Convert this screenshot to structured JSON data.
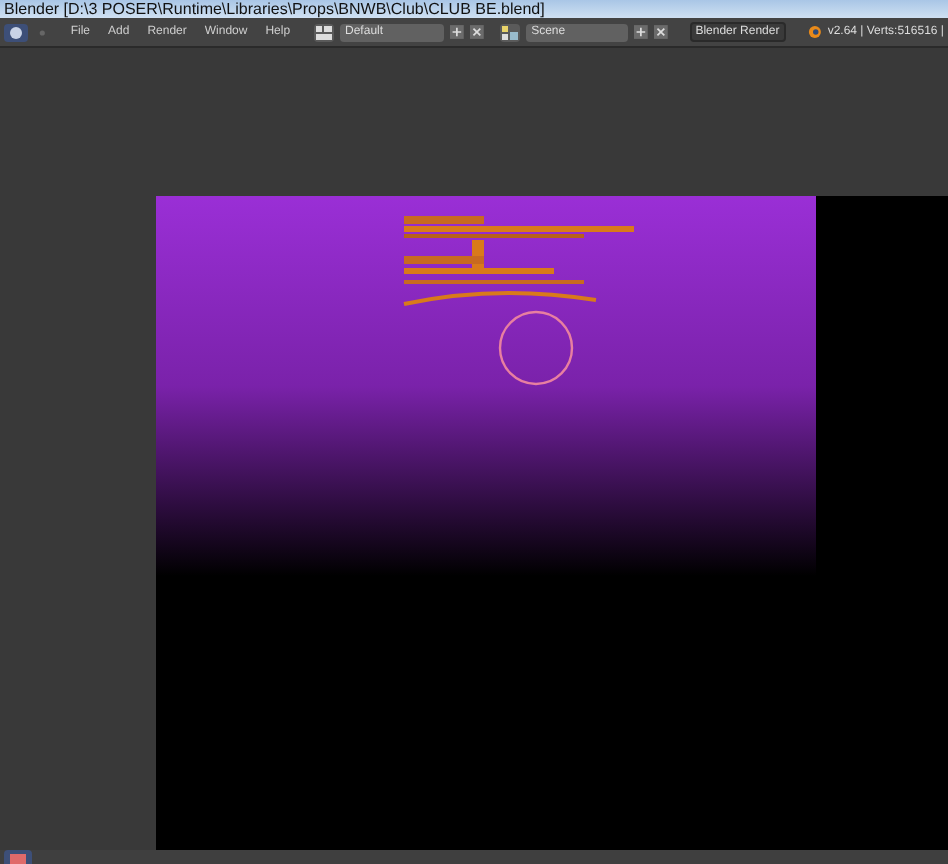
{
  "window": {
    "title": "Blender  [D:\\3 POSER\\Runtime\\Libraries\\Props\\BNWB\\Club\\CLUB BE.blend]"
  },
  "menu": [
    "File",
    "Add",
    "Render",
    "Window",
    "Help"
  ],
  "layout": {
    "value": "Default"
  },
  "scene": {
    "value": "Scene"
  },
  "engine": {
    "value": "Blender Render"
  },
  "info": "v2.64 | Verts:516516 |"
}
